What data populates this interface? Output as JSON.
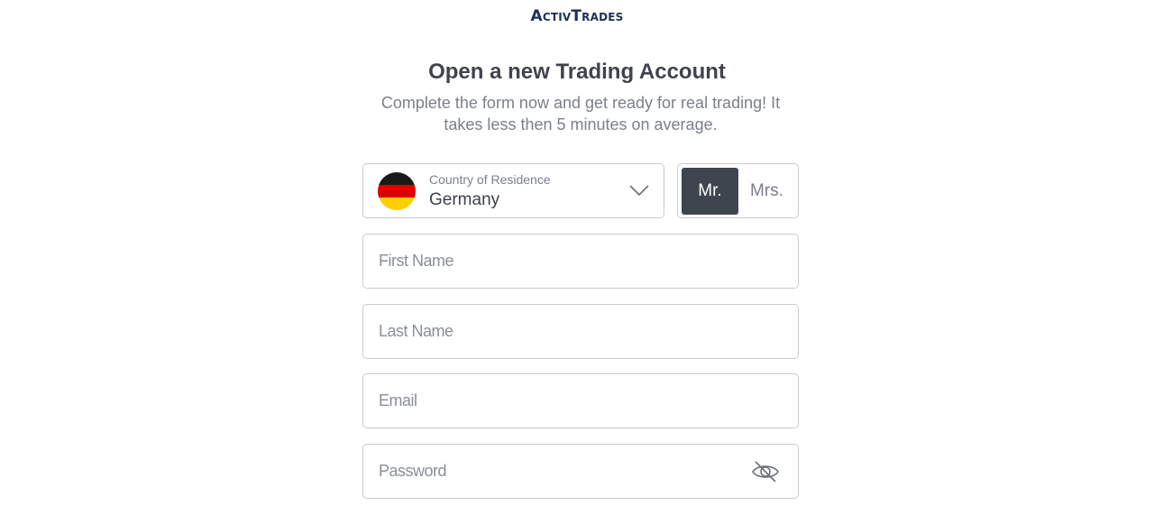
{
  "brand": {
    "logo_text": "ActivTrades"
  },
  "header": {
    "title": "Open a new Trading Account",
    "subtitle": "Complete the form now and get ready for real trading! It takes less then 5 minutes on average."
  },
  "country": {
    "label": "Country of Residence",
    "value": "Germany",
    "flag": "germany-flag"
  },
  "salutation": {
    "options": [
      "Mr.",
      "Mrs."
    ],
    "selected": "Mr."
  },
  "fields": {
    "first_name": {
      "placeholder": "First Name",
      "value": ""
    },
    "last_name": {
      "placeholder": "Last Name",
      "value": ""
    },
    "email": {
      "placeholder": "Email",
      "value": ""
    },
    "password": {
      "placeholder": "Password",
      "value": "",
      "toggle_icon": "eye-slash-icon"
    }
  },
  "colors": {
    "brand_navy": "#1d2f57",
    "selected_bg": "#3e454f",
    "border": "#c8cbd0"
  }
}
